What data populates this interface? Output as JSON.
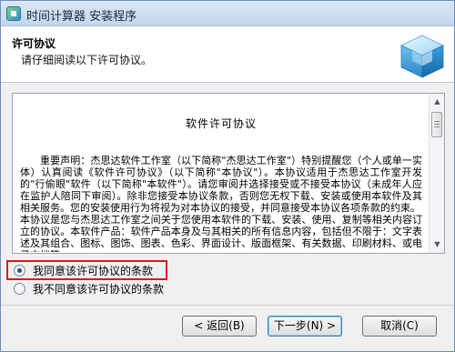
{
  "window": {
    "title": "时间计算器 安装程序"
  },
  "header": {
    "title": "许可协议",
    "subtitle": "请仔细阅读以下许可协议。"
  },
  "license": {
    "title": "软件许可协议",
    "paragraphs": [
      "重要声明：杰思达软件工作室（以下简称\"杰思达工作室\"）特别提醒您（个人或单一实体）认真阅读《软件许可协议》（以下简称\"本协议\"）。本协议适用于杰思达工作室开发的\"行偷眼\"软件（以下简称\"本软件\"）。请您审阅并选择接受或不接受本协议（未成年人应在监护人陪同下审阅）。除非您接受本协议条款，否则您无权下载、安装或使用本软件及其相关服务。您的安装使用行为将视为对本协议的接受，并同意接受本协议各项条款的约束。",
      "本协议是您与杰思达工作室之间关于您使用本软件的下载、安装、使用、复制等相关内容订立的协议。本软件产品：软件产品本身及与其相关的所有信息内容，包括但不限于：文字表述及其组合、图标、图饰、图表、色彩、界面设计、版面框架、有关数据、印刷材料、或电子文档等。"
    ]
  },
  "options": {
    "accept": "我同意该许可协议的条款",
    "decline": "我不同意该许可协议的条款",
    "selected": "accept"
  },
  "buttons": {
    "back": "< 返回(B)",
    "next": "下一步(N) >",
    "cancel": "取消(C)"
  },
  "colors": {
    "highlight_border": "#e3141b",
    "radio_dot": "#1e4f9c"
  }
}
